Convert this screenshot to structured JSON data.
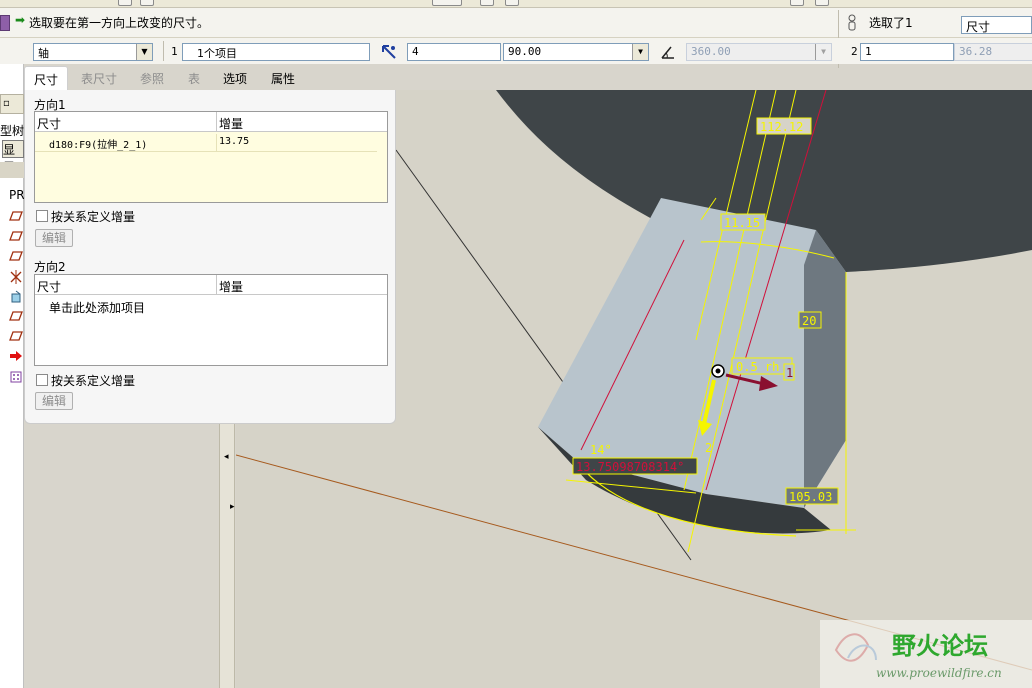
{
  "message": {
    "text": "选取要在第一方向上改变的尺寸。"
  },
  "selection": {
    "status": "选取了1",
    "filter": "尺寸"
  },
  "dashboard": {
    "type_select": "轴",
    "dir1_index": "1",
    "dir1_collector": "1个项目",
    "dir1_count": "4",
    "dir1_angle": "90.00",
    "dir2_angle": "360.00",
    "dir2_index": "2",
    "dir2_count": "1",
    "dir2_value": "36.28"
  },
  "tabs": [
    {
      "label": "尺寸",
      "active": true
    },
    {
      "label": "表尺寸",
      "active": false
    },
    {
      "label": "参照",
      "active": false
    },
    {
      "label": "表",
      "active": false
    },
    {
      "label": "选项",
      "active": false
    },
    {
      "label": "属性",
      "active": false
    }
  ],
  "panel": {
    "dir1": {
      "title": "方向1",
      "col_dim": "尺寸",
      "col_inc": "增量",
      "rows": [
        {
          "dim": "d180:F9(拉伸_2_1)",
          "inc": "13.75"
        }
      ],
      "checkbox_label": "按关系定义增量",
      "edit_label": "编辑"
    },
    "dir2": {
      "title": "方向2",
      "col_dim": "尺寸",
      "col_inc": "增量",
      "placeholder": "单击此处添加项目",
      "checkbox_label": "按关系定义增量",
      "edit_label": "编辑"
    }
  },
  "tree": {
    "hdr1": "▫",
    "hdr2": "型树",
    "hdr3": "显示",
    "root": "PR"
  },
  "model": {
    "dim_top": "112.12",
    "dim_width": "11.15",
    "dim_side": "20",
    "dim_chip": "0.5 rh",
    "dim_chip2": "1",
    "dim_angle": "14°",
    "dim_arc": "13.75098708314°",
    "dim_two": "2",
    "dim_bottom": "105.03"
  },
  "watermark": {
    "text": "野火论坛",
    "url": "www.proewildfire.cn"
  },
  "colors": {
    "accent_yellow": "#f5f500",
    "dim_red": "#d0103a",
    "dark_body": "#3f4548",
    "part_face": "#b8c4cc",
    "watermark_green": "#2ea82e"
  }
}
